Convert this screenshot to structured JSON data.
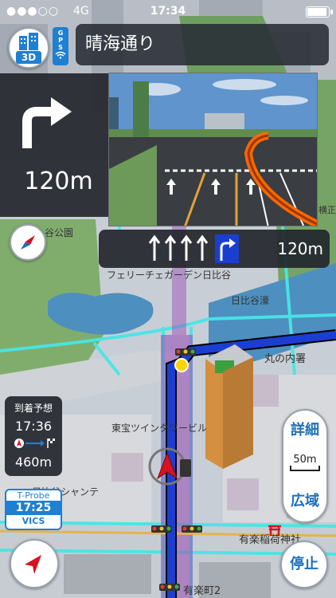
{
  "status_bar": {
    "carrier_signal": "●●●○○",
    "network": "4G",
    "time": "17:34",
    "battery_level": 0.85
  },
  "top_controls": {
    "view_mode_label": "3D",
    "gps_label": "GPS",
    "road_name": "晴海通り"
  },
  "guidance": {
    "turn_direction": "right",
    "turn_distance": "120m",
    "lane_distance": "120m",
    "lanes": [
      "straight",
      "straight",
      "straight",
      "straight",
      "right"
    ]
  },
  "map_labels": {
    "park_label": "谷公園",
    "garden_label": "フェリーチェガーデン日比谷",
    "hibiya_moat": "日比谷濠",
    "marunouchi": "丸の内署",
    "toho_twin_tower": "東宝ツインタワービル",
    "hibiya_chanter": "日比谷シャンテ",
    "yurakucho_inari": "有楽稲荷神社",
    "yurakucho_2": "有楽町2",
    "yokocho": "横正",
    "route_name": "晴海通り"
  },
  "arrival": {
    "label": "到着予想",
    "time": "17:36",
    "distance": "460m"
  },
  "probe": {
    "label": "T-Probe",
    "time": "17:25",
    "source": "VICS"
  },
  "zoom": {
    "detail_label": "詳細",
    "scale": "50m",
    "wide_label": "広域"
  },
  "controls": {
    "stop_label": "停止"
  },
  "colors": {
    "accent_blue": "#1f7fd1",
    "route_blue": "#1a3fd0",
    "panel_dark": "#23262d",
    "road_cyan": "#48e6e6",
    "park_green": "#7fb06c",
    "water_blue": "#4d8fbf",
    "vehicle_red": "#d8121e"
  }
}
